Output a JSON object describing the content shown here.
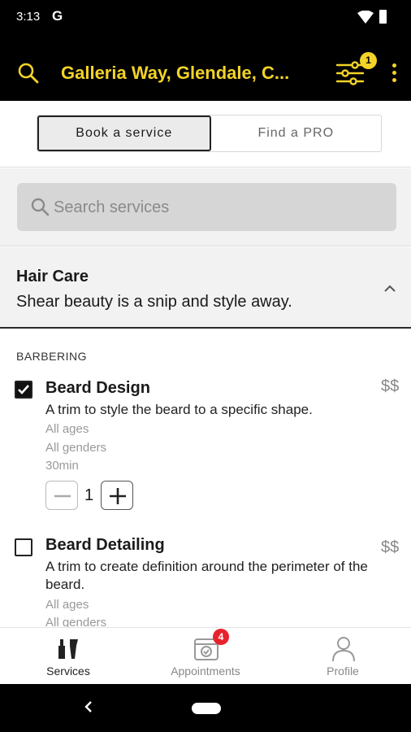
{
  "status_bar": {
    "time": "3:13",
    "google_label": "G"
  },
  "app_bar": {
    "title": "Galleria Way, Glendale, C...",
    "filter_badge_count": "1",
    "accent_color": "#f3d327"
  },
  "segments": {
    "book_label": "Book a service",
    "find_label": "Find a PRO",
    "selected": "Book a service"
  },
  "search": {
    "placeholder": "Search services"
  },
  "category": {
    "name": "Hair Care",
    "description": "Shear beauty is a snip and style away."
  },
  "list": {
    "section_label": "BARBERING",
    "services": [
      {
        "name": "Beard Design",
        "price": "$$",
        "description": "A trim to style the beard to a specific shape.",
        "ages": "All ages",
        "genders": "All genders",
        "duration": "30min",
        "checked": true,
        "quantity": "1"
      },
      {
        "name": "Beard Detailing",
        "price": "$$",
        "description": "A trim to create definition around the perimeter of the beard.",
        "ages": "All ages",
        "genders": "All genders",
        "checked": false
      }
    ]
  },
  "bottom_nav": {
    "items": [
      {
        "label": "Services",
        "icon": "services-icon",
        "active": true
      },
      {
        "label": "Appointments",
        "icon": "calendar-check-icon",
        "badge": "4"
      },
      {
        "label": "Profile",
        "icon": "person-icon"
      }
    ]
  }
}
